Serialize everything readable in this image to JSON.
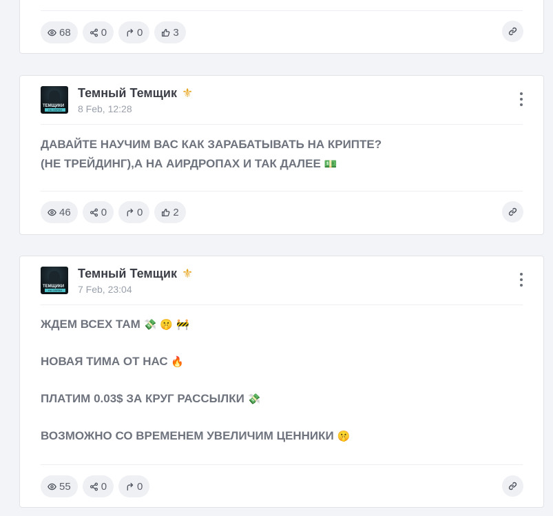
{
  "posts": [
    {
      "stats": {
        "views": "68",
        "shares": "0",
        "forwards": "0",
        "likes": "3"
      }
    },
    {
      "author": "Темный Темщик",
      "author_badge": "⚜",
      "avatar_text": {
        "line1": "ТЕМЩИКИ",
        "line2": "НА СВЯЗИ"
      },
      "date": "8 Feb, 12:28",
      "lines": [
        "ДАВАЙТЕ НАУЧИМ ВАС КАК ЗАРАБАТЫВАТЬ НА КРИПТЕ?",
        "(НЕ ТРЕЙДИНГ),А НА АИРДРОПАХ И ТАК ДАЛЕЕ"
      ],
      "line_emojis": [
        "",
        "💵"
      ],
      "stats": {
        "views": "46",
        "shares": "0",
        "forwards": "0",
        "likes": "2"
      }
    },
    {
      "author": "Темный Темщик",
      "author_badge": "⚜",
      "avatar_text": {
        "line1": "ТЕМЩИКИ",
        "line2": "НА СВЯЗИ"
      },
      "date": "7 Feb, 23:04",
      "lines": [
        "ЖДЕМ ВСЕХ ТАМ",
        "НОВАЯ ТИМА ОТ НАС",
        "ПЛАТИМ 0.03$ ЗА КРУГ РАССЫЛКИ",
        "ВОЗМОЖНО СО ВРЕМЕНЕМ УВЕЛИЧИМ ЦЕННИКИ"
      ],
      "line_emojis": [
        "💸 🤫 🚧",
        "🔥",
        "💸",
        "🤫"
      ],
      "stats": {
        "views": "55",
        "shares": "0",
        "forwards": "0"
      }
    }
  ],
  "icons": {
    "views": "eye-icon",
    "shares": "share-icon",
    "forwards": "forward-icon",
    "likes": "thumbs-up-icon",
    "link": "link-icon",
    "more": "more-vertical-icon"
  }
}
